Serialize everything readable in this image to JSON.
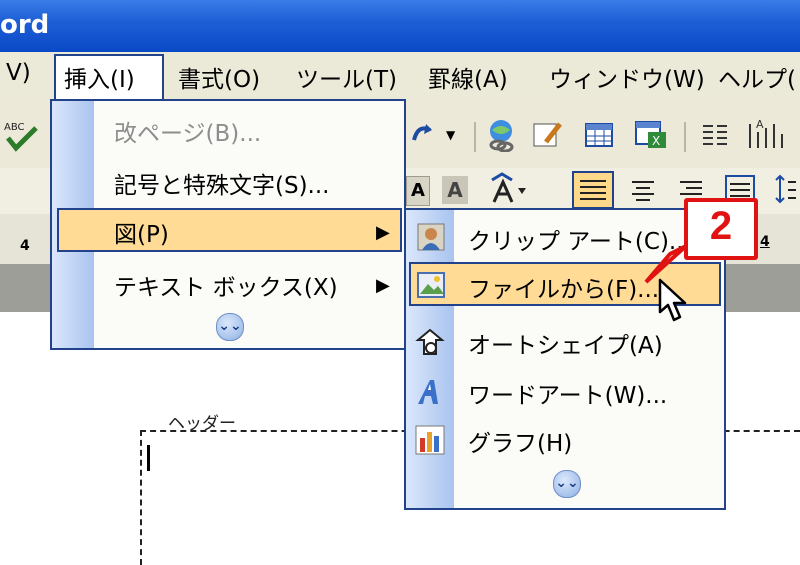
{
  "window": {
    "title_fragment": "ord"
  },
  "menubar": {
    "items": [
      {
        "label": "V)"
      },
      {
        "label": "挿入(I)"
      },
      {
        "label": "書式(O)"
      },
      {
        "label": "ツール(T)"
      },
      {
        "label": "罫線(A)"
      },
      {
        "label": "ウィンドウ(W)"
      },
      {
        "label": "ヘルプ("
      }
    ]
  },
  "ruler": {
    "tick": "4"
  },
  "insert_menu": {
    "items": [
      {
        "label": "改ページ(B)...",
        "disabled": true
      },
      {
        "label": "記号と特殊文字(S)..."
      },
      {
        "label": "図(P)",
        "highlighted": true,
        "submenu": true
      },
      {
        "label": "テキスト ボックス(X)",
        "submenu": true
      }
    ],
    "expand_icon": "double-chevron-down-icon"
  },
  "picture_submenu": {
    "items": [
      {
        "label": "クリップ アート(C)...",
        "icon": "clip-art-icon"
      },
      {
        "label": "ファイルから(F)...",
        "icon": "picture-from-file-icon",
        "highlighted": true
      },
      {
        "label": "オートシェイプ(A)",
        "icon": "autoshape-icon"
      },
      {
        "label": "ワードアート(W)...",
        "icon": "wordart-icon"
      },
      {
        "label": "グラフ(H)",
        "icon": "chart-icon"
      }
    ],
    "expand_icon": "double-chevron-down-icon"
  },
  "callout": {
    "number": "2",
    "color": "#e11212"
  },
  "document": {
    "header_label": "ヘッダー"
  },
  "colors": {
    "highlight": "#ffdb96",
    "menu_border": "#22428b",
    "titlebar": "#1f5fd6"
  }
}
